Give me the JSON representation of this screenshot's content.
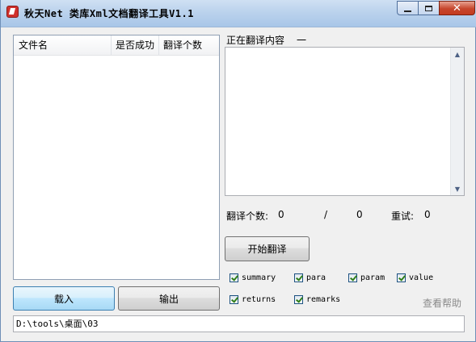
{
  "window": {
    "title": "秋天Net 类库Xml文档翻译工具V1.1",
    "minimize_symbol": "",
    "close_symbol": "✕"
  },
  "file_list": {
    "columns": [
      "文件名",
      "是否成功",
      "翻译个数"
    ],
    "rows": []
  },
  "buttons": {
    "load": "载入",
    "export": "输出",
    "start": "开始翻译",
    "help": "查看帮助"
  },
  "path": "D:\\tools\\桌面\\03",
  "translating": {
    "label": "正在翻译内容",
    "value": "一",
    "content": ""
  },
  "stats": {
    "count_label": "翻译个数:",
    "done": "0",
    "separator": "/",
    "total": "0",
    "retry_label": "重试:",
    "retry": "0"
  },
  "options": [
    {
      "label": "summary",
      "checked": true
    },
    {
      "label": "para",
      "checked": true
    },
    {
      "label": "param",
      "checked": true
    },
    {
      "label": "value",
      "checked": true
    },
    {
      "label": "returns",
      "checked": true
    },
    {
      "label": "remarks",
      "checked": true
    }
  ]
}
